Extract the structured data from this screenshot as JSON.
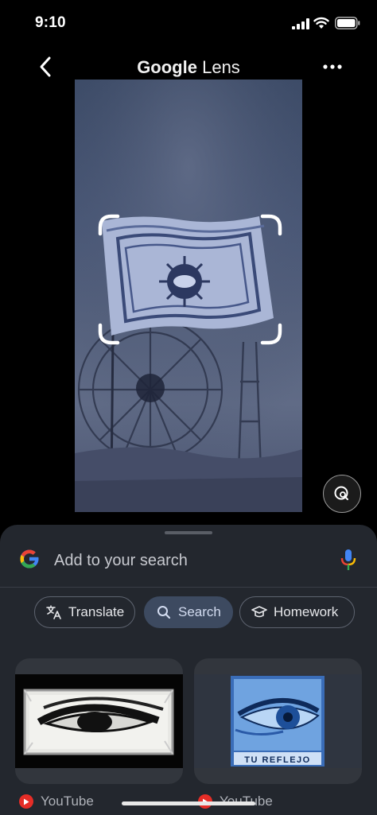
{
  "status_bar": {
    "time": "9:10"
  },
  "header": {
    "title_brand": "Google",
    "title_product": "Lens"
  },
  "search": {
    "placeholder": "Add to your search"
  },
  "chips": [
    {
      "label": "Translate",
      "icon": "translate-icon"
    },
    {
      "label": "Search",
      "icon": "search-icon",
      "selected": true
    },
    {
      "label": "Homework",
      "icon": "graduation-cap-icon"
    }
  ],
  "results": [
    {
      "source": "YouTube",
      "thumbnail": "eye-black-white"
    },
    {
      "source": "YouTube",
      "thumbnail": "eye-blue",
      "caption": "TU REFLEJO"
    }
  ],
  "colors": {
    "sheet": "#23272e",
    "chip_selected": "#3d4a60",
    "youtube_red": "#e52d27",
    "google_blue": "#4285F4",
    "google_red": "#EA4335",
    "google_yellow": "#FBBC05",
    "google_green": "#34A853"
  }
}
